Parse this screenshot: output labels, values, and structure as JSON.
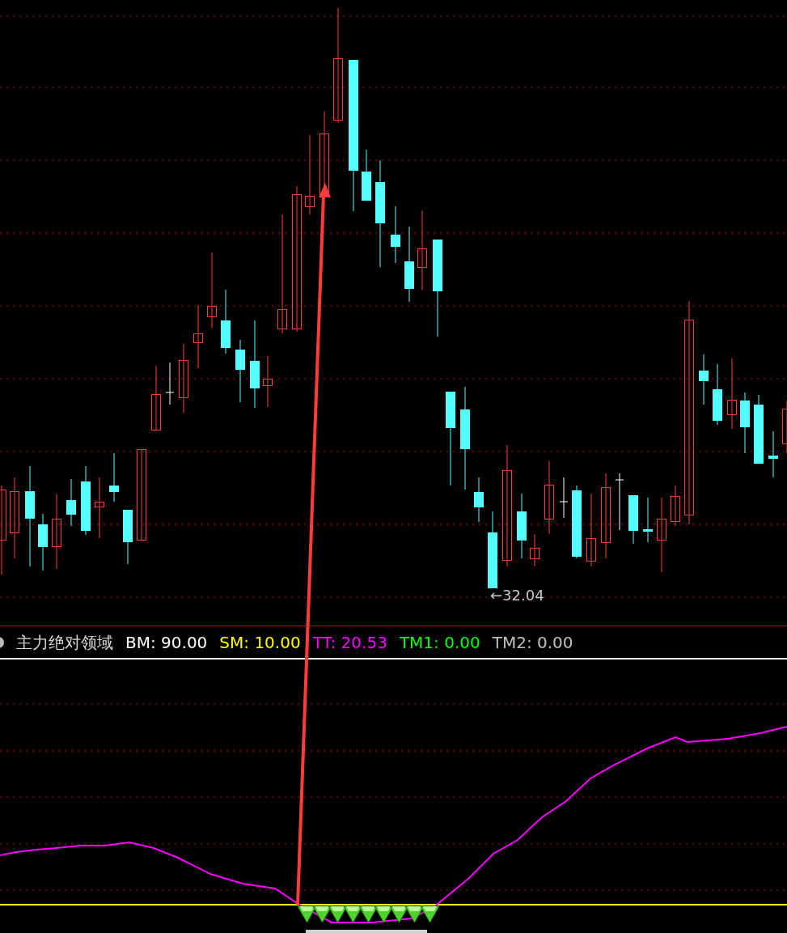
{
  "price_chart": {
    "low_marker": "←32.04"
  },
  "indicator": {
    "title": "主力绝对领域",
    "values": [
      {
        "text": "BM: 90.00",
        "color": "#ffffff"
      },
      {
        "text": "SM: 10.00",
        "color": "#ffff00"
      },
      {
        "text": "TT: 20.53",
        "color": "#ff00ff"
      },
      {
        "text": "TM1: 0.00",
        "color": "#00ff00"
      },
      {
        "text": "TM2: 0.00",
        "color": "#c0c0c0"
      }
    ]
  }
}
